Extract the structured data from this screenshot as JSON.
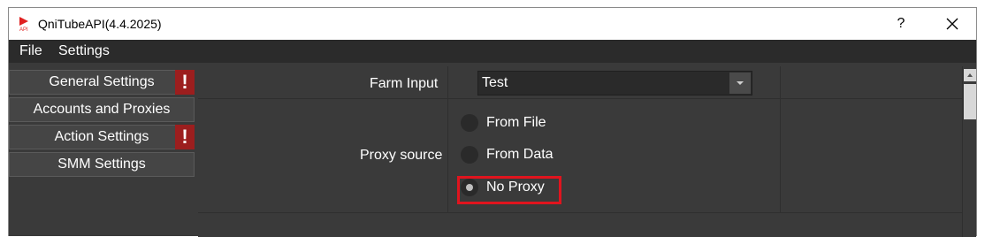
{
  "window": {
    "title": "QniTubeAPI(4.4.2025)",
    "help_label": "?",
    "icon_name": "app-logo-icon",
    "close_icon": "close-icon"
  },
  "menubar": {
    "items": [
      {
        "label": "File"
      },
      {
        "label": "Settings"
      }
    ]
  },
  "sidebar": {
    "items": [
      {
        "label": "General Settings",
        "warning": "!"
      },
      {
        "label": "Accounts and Proxies"
      },
      {
        "label": "Action Settings",
        "warning": "!"
      },
      {
        "label": "SMM Settings"
      }
    ]
  },
  "form": {
    "farm_input": {
      "label": "Farm Input",
      "value": "Test"
    },
    "proxy_source": {
      "label": "Proxy source",
      "options": [
        {
          "label": "From File",
          "selected": false
        },
        {
          "label": "From Data",
          "selected": false
        },
        {
          "label": "No Proxy",
          "selected": true
        }
      ]
    }
  },
  "colors": {
    "accent_highlight": "#e0141e",
    "warning_badge": "#9c1e1e",
    "background": "#3a3a3a"
  }
}
